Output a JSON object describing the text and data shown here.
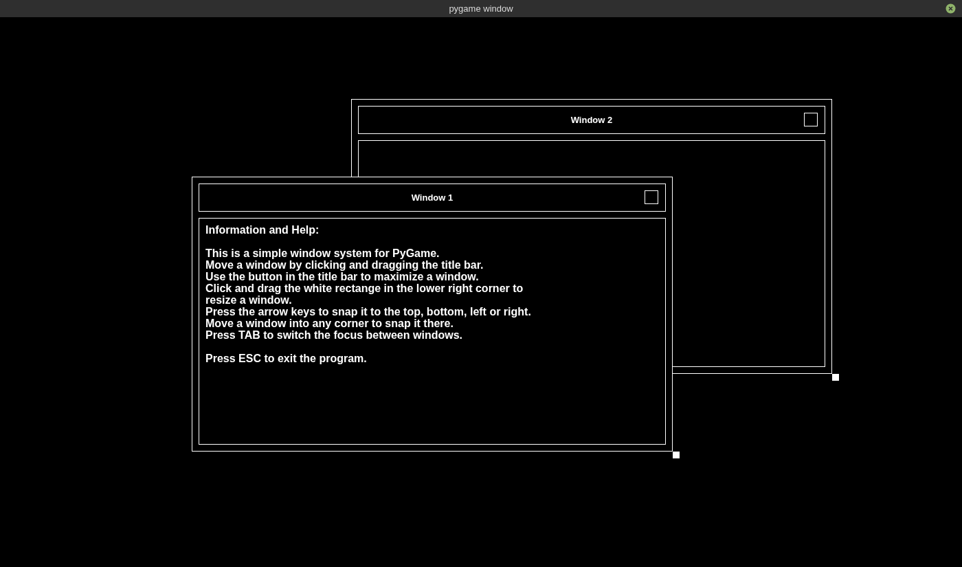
{
  "app_window": {
    "title": "pygame window"
  },
  "windows": [
    {
      "title": "Window 2"
    },
    {
      "title": "Window 1",
      "paragraphs": [
        [
          "Information and Help:"
        ],
        [
          "This is a simple window system for PyGame.",
          "Move a window by clicking and dragging the title bar.",
          "Use the button in the title bar to maximize a window.",
          "Click and drag the white rectange in the lower right corner to",
          "resize a window.",
          "Press the arrow keys to snap it to the top, bottom, left or right.",
          "Move a window into any corner to snap it there.",
          "Press TAB to switch the focus between windows."
        ],
        [
          "Press ESC to exit the program."
        ]
      ]
    }
  ]
}
